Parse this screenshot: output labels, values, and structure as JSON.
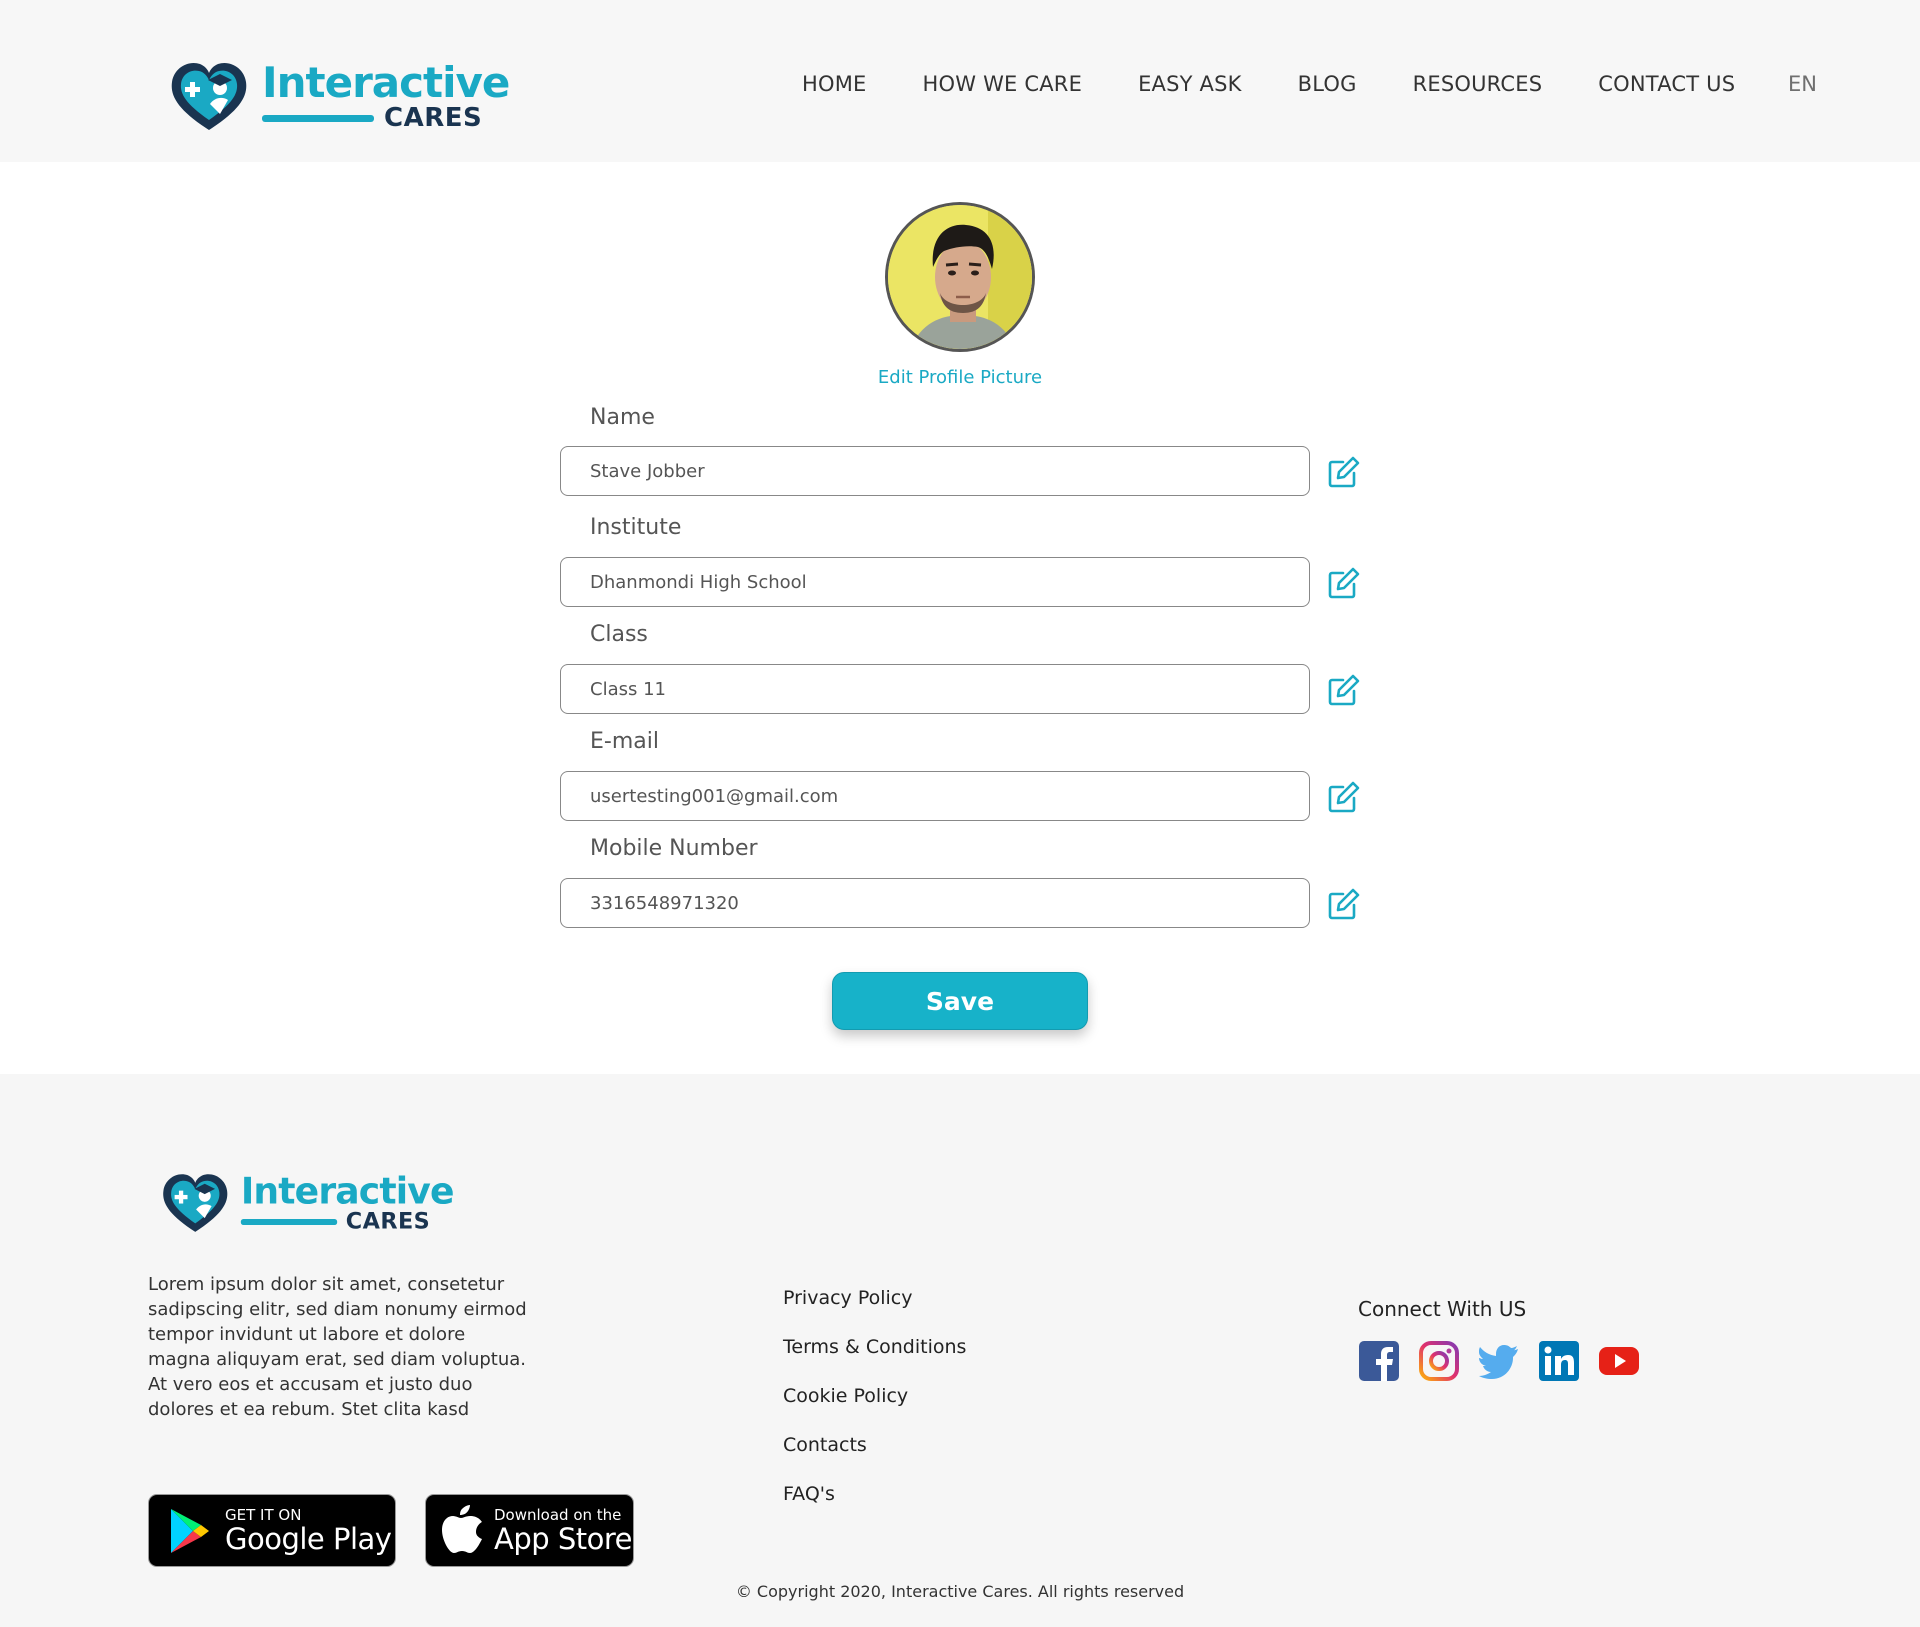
{
  "header": {
    "logo": {
      "word1": "Interactive",
      "word2": "CARES"
    },
    "nav": [
      {
        "label": "HOME"
      },
      {
        "label": "HOW WE CARE"
      },
      {
        "label": "EASY ASK"
      },
      {
        "label": "BLOG"
      },
      {
        "label": "RESOURCES"
      },
      {
        "label": "CONTACT US"
      }
    ],
    "language": "EN"
  },
  "profile": {
    "edit_picture_label": "Edit Profile Picture",
    "fields": [
      {
        "label": "Name",
        "value": "Stave Jobber"
      },
      {
        "label": "Institute",
        "value": "Dhanmondi High School"
      },
      {
        "label": "Class",
        "value": "Class 11"
      },
      {
        "label": "E-mail",
        "value": "usertesting001@gmail.com"
      },
      {
        "label": "Mobile Number",
        "value": "3316548971320"
      }
    ],
    "save_label": "Save"
  },
  "footer": {
    "logo": {
      "word1": "Interactive",
      "word2": "CARES"
    },
    "description": "Lorem ipsum dolor sit amet, consetetur sadipscing elitr, sed diam nonumy eirmod tempor invidunt ut labore et dolore magna aliquyam erat, sed diam voluptua. At vero eos et accusam et justo duo dolores et ea rebum. Stet clita kasd",
    "google_play": {
      "small": "GET IT ON",
      "big": "Google Play"
    },
    "app_store": {
      "small": "Download on the",
      "big": "App Store"
    },
    "links": [
      {
        "label": "Privacy Policy"
      },
      {
        "label": "Terms & Conditions"
      },
      {
        "label": "Cookie Policy"
      },
      {
        "label": "Contacts"
      },
      {
        "label": "FAQ's"
      }
    ],
    "connect_title": "Connect With US",
    "socials": [
      "facebook-icon",
      "instagram-icon",
      "twitter-icon",
      "linkedin-icon",
      "youtube-icon"
    ],
    "copyright": "© Copyright 2020, Interactive Cares. All rights reserved"
  },
  "colors": {
    "accent": "#17b2c9",
    "brand_dark": "#1a3450",
    "header_bg": "#f7f7f7",
    "footer_bg": "#f6f6f6"
  }
}
